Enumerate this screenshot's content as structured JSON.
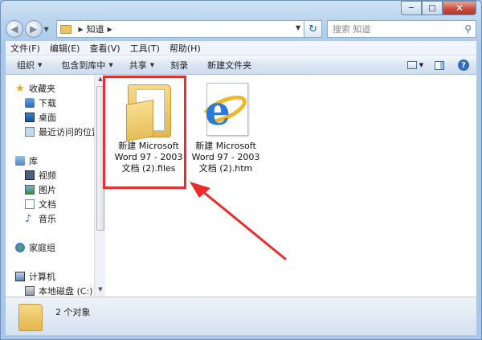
{
  "address": {
    "crumb": "知道"
  },
  "search": {
    "placeholder": "搜索 知道"
  },
  "menu": [
    "文件(F)",
    "编辑(E)",
    "查看(V)",
    "工具(T)",
    "帮助(H)"
  ],
  "toolbar": {
    "organize": "组织",
    "include": "包含到库中",
    "share": "共享",
    "burn": "刻录",
    "new_folder": "新建文件夹"
  },
  "sidebar": {
    "favorites": "收藏夹",
    "downloads": "下载",
    "desktop": "桌面",
    "recent": "最近访问的位置",
    "libraries": "库",
    "videos": "视频",
    "pictures": "图片",
    "documents": "文档",
    "music": "音乐",
    "homegroup": "家庭组",
    "computer": "计算机",
    "local_disk": "本地磁盘 (C:)"
  },
  "files": [
    {
      "name": "新建 Microsoft Word 97 - 2003 文档 (2).files",
      "type": "folder"
    },
    {
      "name": "新建 Microsoft Word 97 - 2003 文档 (2).htm",
      "type": "ie-html"
    }
  ],
  "status": {
    "count": "2 个对象"
  },
  "colors": {
    "highlight": "#ee2b2b",
    "window": "#a9c7ea"
  }
}
